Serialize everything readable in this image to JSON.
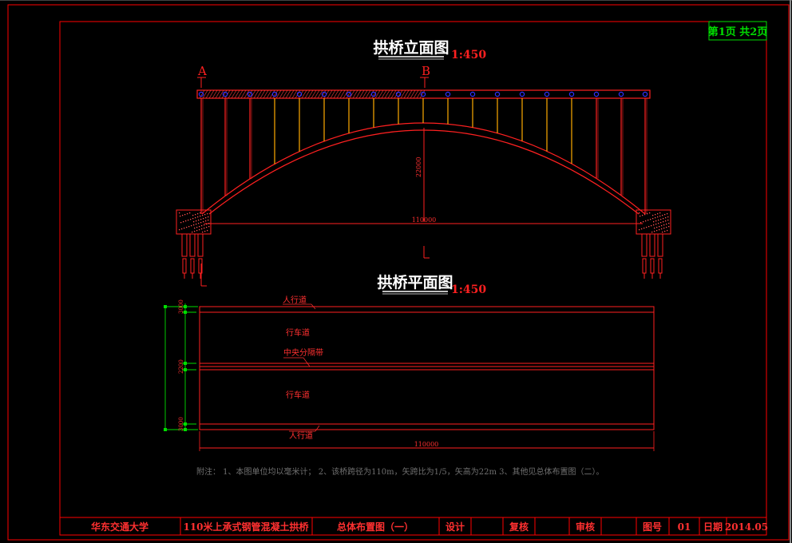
{
  "sheet": {
    "page_label": "第1页 共2页"
  },
  "elevation": {
    "title": "拱桥立面图",
    "scale": "1:450",
    "section_a": "A",
    "section_b": "B",
    "rise_dim": "22000",
    "span_dim": "110000"
  },
  "plan": {
    "title": "拱桥平面图",
    "scale": "1:450",
    "labels": {
      "sidewalk_top": "人行道",
      "carriageway_top": "行车道",
      "median": "中央分隔带",
      "carriageway_bottom": "行车道",
      "sidewalk_bottom": "人行道"
    },
    "dims": {
      "width_top": "3000",
      "median_width": "2200",
      "width_bottom": "3000",
      "span": "110000"
    }
  },
  "notes": "附注： 1、本图单位均以毫米计；  2、该桥跨径为110m，矢跨比为1/5，矢高为22m  3、其他见总体布置图（二）。",
  "title_block": {
    "school": "华东交通大学",
    "project": "110米上承式钢管混凝土拱桥",
    "drawing_name": "总体布置图（一）",
    "design_label": "设计",
    "review_label": "复核",
    "approve_label": "审核",
    "drawing_no_label": "图号",
    "drawing_no": "01",
    "date_label": "日期",
    "date": "2014.05"
  },
  "colors": {
    "line": "#ff0000",
    "dim": "#ff3030",
    "green": "#00dd00",
    "blue": "#3030ff",
    "hanger": "#ffaa00",
    "white": "#ffffff",
    "bg": "#000000"
  }
}
